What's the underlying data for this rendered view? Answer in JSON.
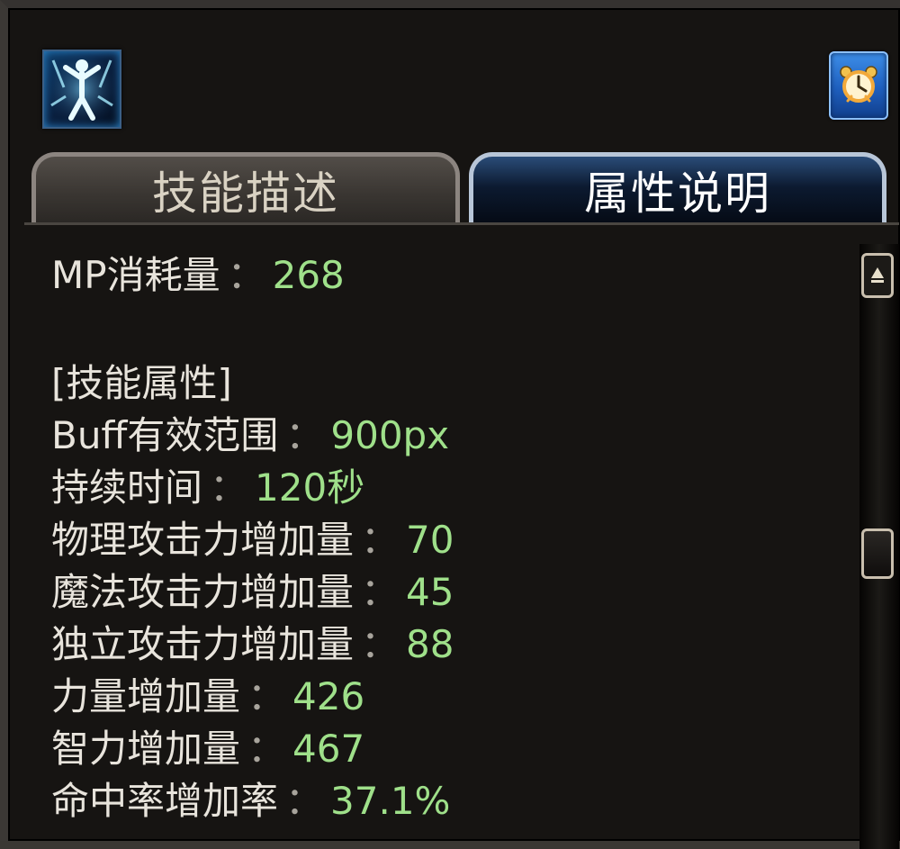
{
  "skill_icon": "skill-buff-figure-icon",
  "clock_icon": "alarm-clock-icon",
  "tabs": [
    {
      "label": "技能描述",
      "active": false
    },
    {
      "label": "属性说明",
      "active": true
    }
  ],
  "mp": {
    "label": "MP消耗量",
    "value": "268"
  },
  "section_title": "[技能属性]",
  "attributes": [
    {
      "label": "Buff有效范围",
      "value": "900px"
    },
    {
      "label": "持续时间",
      "value": "120秒"
    },
    {
      "label": "物理攻击力增加量",
      "value": "70"
    },
    {
      "label": "魔法攻击力增加量",
      "value": "45"
    },
    {
      "label": "独立攻击力增加量",
      "value": "88"
    },
    {
      "label": "力量增加量",
      "value": "426"
    },
    {
      "label": "智力增加量",
      "value": "467"
    },
    {
      "label": "命中率增加率",
      "value": "37.1%"
    }
  ],
  "separator": "：",
  "colors": {
    "value": "#9fe08a",
    "text": "#e8e4dc",
    "panel": "#161412",
    "active_tab": "#0c1a30"
  }
}
